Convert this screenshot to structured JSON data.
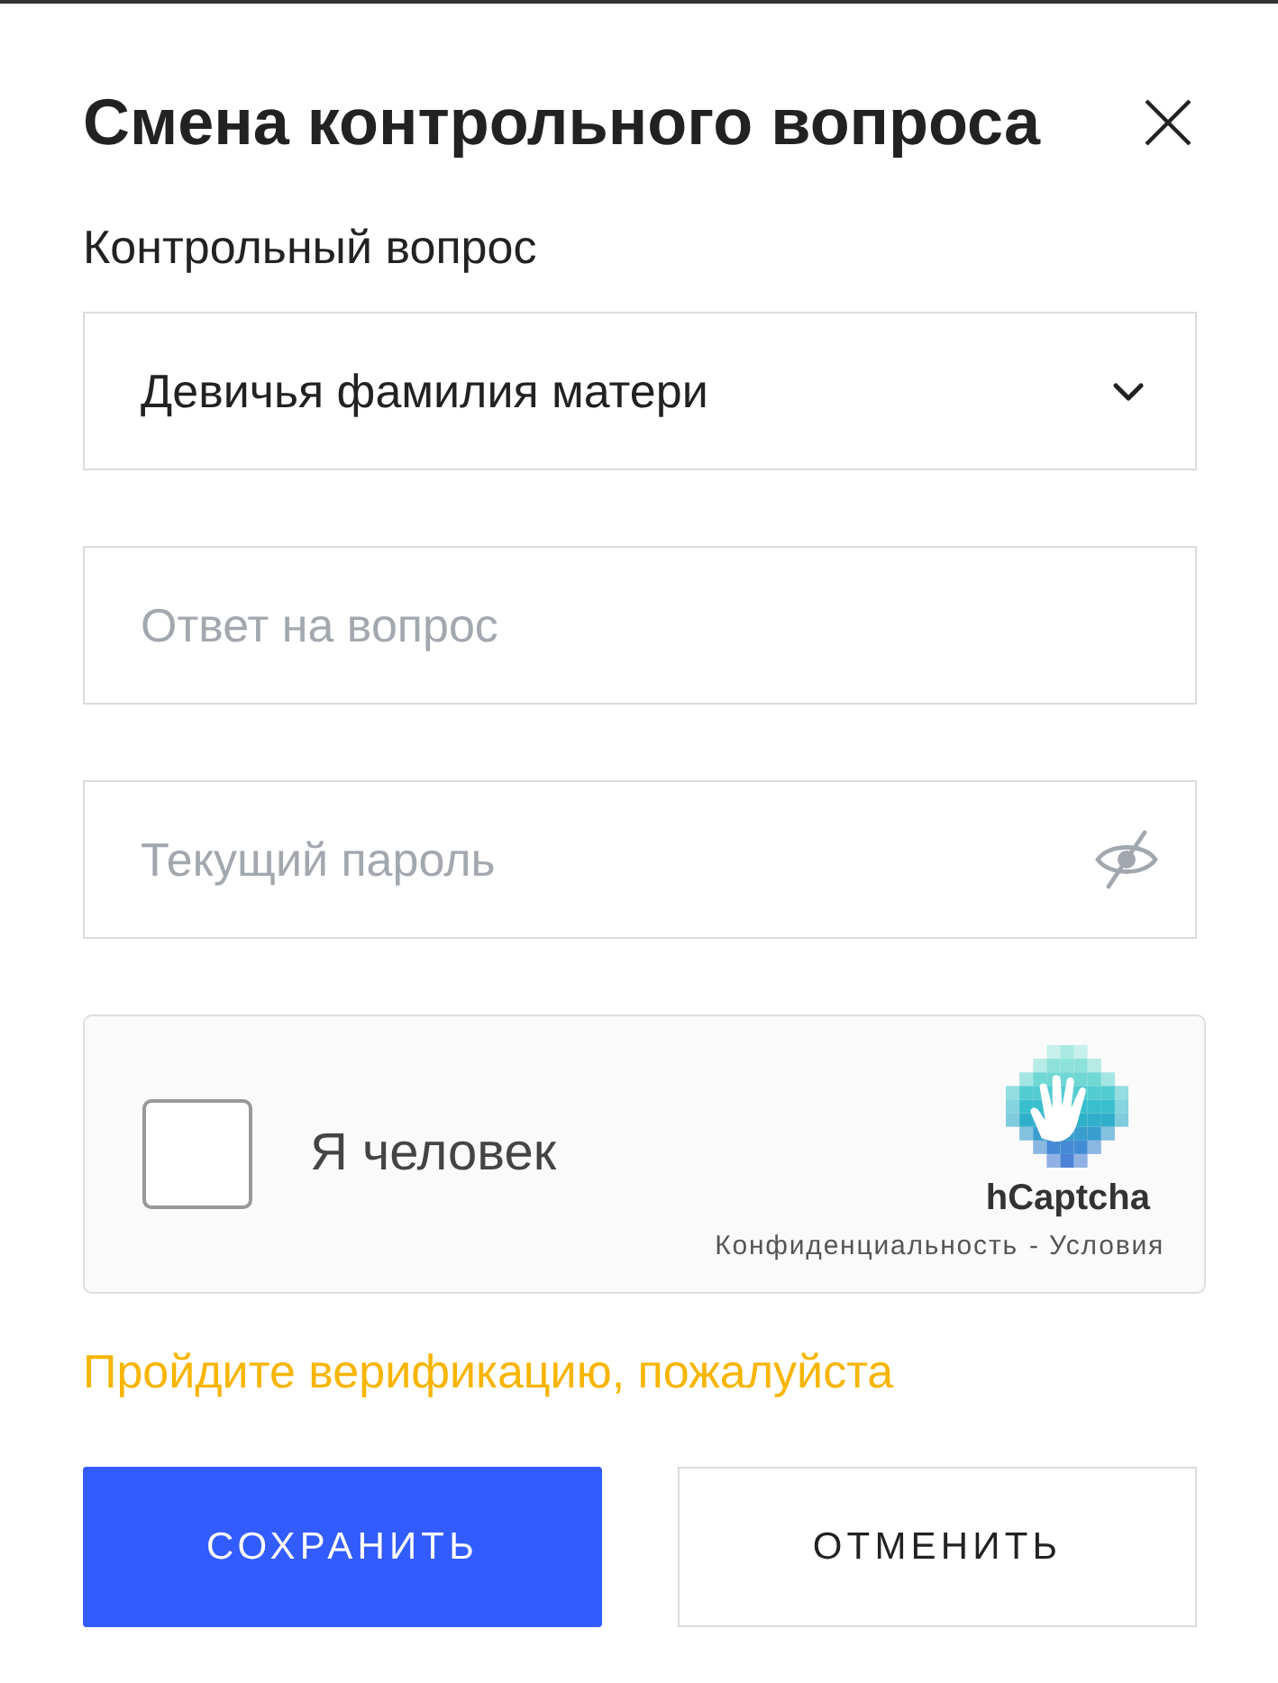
{
  "dialog": {
    "title": "Смена контрольного вопроса"
  },
  "question_label": "Контрольный вопрос",
  "question_select": {
    "value": "Девичья фамилия матери"
  },
  "answer_field": {
    "placeholder": "Ответ на вопрос"
  },
  "password_field": {
    "placeholder": "Текущий пароль",
    "password_visible": false
  },
  "captcha": {
    "checked": false,
    "label": "Я человек",
    "brand": "hCaptcha",
    "links": [
      "Конфиденциальность",
      "Условия"
    ],
    "separator": "-"
  },
  "error": "Пройдите верификацию, пожалуйста",
  "buttons": [
    {
      "label": "СОХРАНИТЬ",
      "kind": "primary"
    },
    {
      "label": "ОТМЕНИТЬ",
      "kind": "secondary"
    }
  ]
}
